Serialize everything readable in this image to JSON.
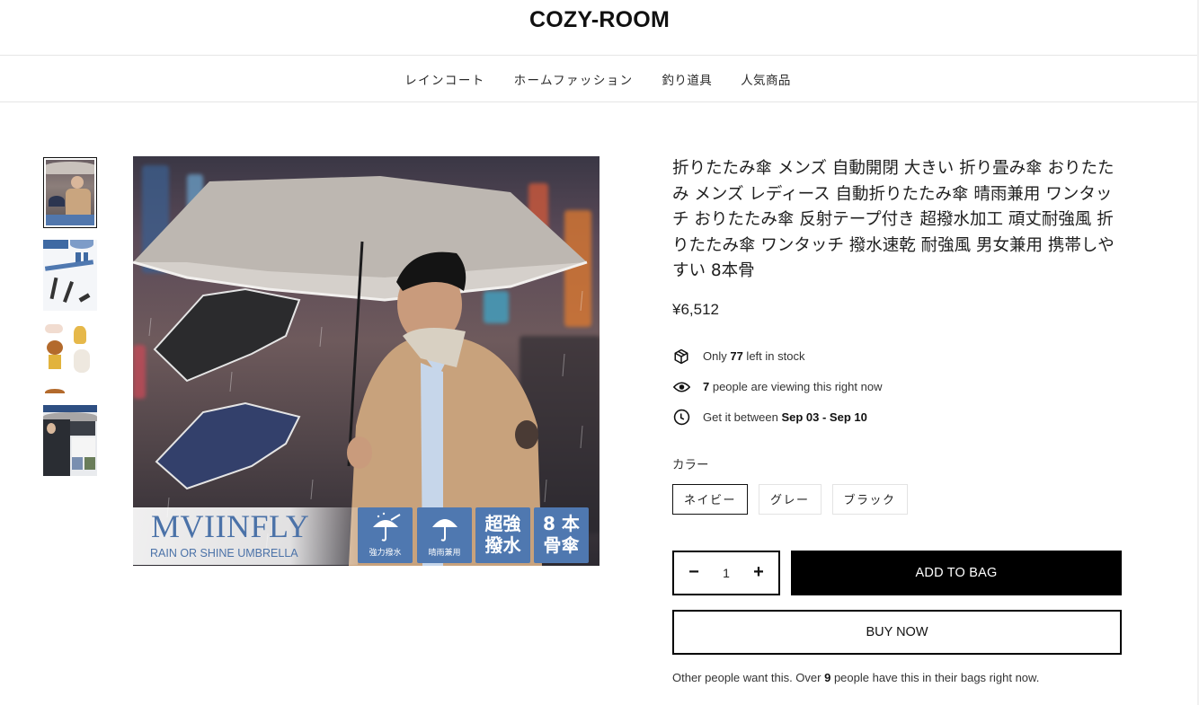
{
  "store": {
    "name": "COZY-ROOM"
  },
  "nav": {
    "items": [
      {
        "label": "レインコート"
      },
      {
        "label": "ホームファッション"
      },
      {
        "label": "釣り道具"
      },
      {
        "label": "人気商品"
      }
    ]
  },
  "gallery": {
    "thumbnails": [
      {
        "alt": "男性が傘を差している商品画像",
        "active": true
      },
      {
        "alt": "逆戻り防止機能付き 説明画像",
        "active": false
      },
      {
        "alt": "イラストキャラクター説明画像",
        "active": false
      },
      {
        "alt": "女性が傘を使用している説明画像",
        "active": false
      }
    ],
    "main_image": {
      "alt": "MVIINFLY 折りたたみ傘 商品画像",
      "brand_text": "MVIINFLY",
      "brand_subtext": "RAIN OR SHINE UMBRELLA",
      "features": [
        {
          "icon": "umbrella-rain-icon",
          "label": "強力撥水"
        },
        {
          "icon": "umbrella-icon",
          "label": "晴雨兼用"
        },
        {
          "big": "超強 撥水"
        },
        {
          "big": "8 本 骨傘"
        }
      ]
    }
  },
  "product": {
    "title": "折りたたみ傘 メンズ 自動開閉 大きい 折り畳み傘 おりたたみ メンズ レディース 自動折りたたみ傘 晴雨兼用 ワンタッチ おりたたみ傘 反射テープ付き 超撥水加工 頑丈耐強風 折りたたみ傘 ワンタッチ 撥水速乾 耐強風 男女兼用 携帯しやすい 8本骨",
    "price": "¥6,512",
    "stock": {
      "prefix": "Only ",
      "count": "77",
      "suffix": " left in stock",
      "icon": "box-icon"
    },
    "viewers": {
      "count": "7",
      "suffix": " people are viewing this right now",
      "icon": "eye-icon"
    },
    "delivery": {
      "prefix": "Get it between ",
      "range": "Sep 03 - Sep 10",
      "icon": "clock-icon"
    },
    "color": {
      "label": "カラー",
      "options": [
        {
          "label": "ネイビー",
          "selected": true
        },
        {
          "label": "グレー",
          "selected": false
        },
        {
          "label": "ブラック",
          "selected": false
        }
      ]
    },
    "quantity": {
      "value": "1",
      "minus": "−",
      "plus": "+"
    },
    "add_to_bag": "ADD TO BAG",
    "buy_now": "BUY NOW",
    "social_proof": {
      "prefix": "Other people want this. Over ",
      "count": "9",
      "suffix": " people have this in their bags right now."
    }
  },
  "colors": {
    "accent": "#000000",
    "banner_blue": "#4f78b0",
    "border_light": "#e3e3e3"
  }
}
